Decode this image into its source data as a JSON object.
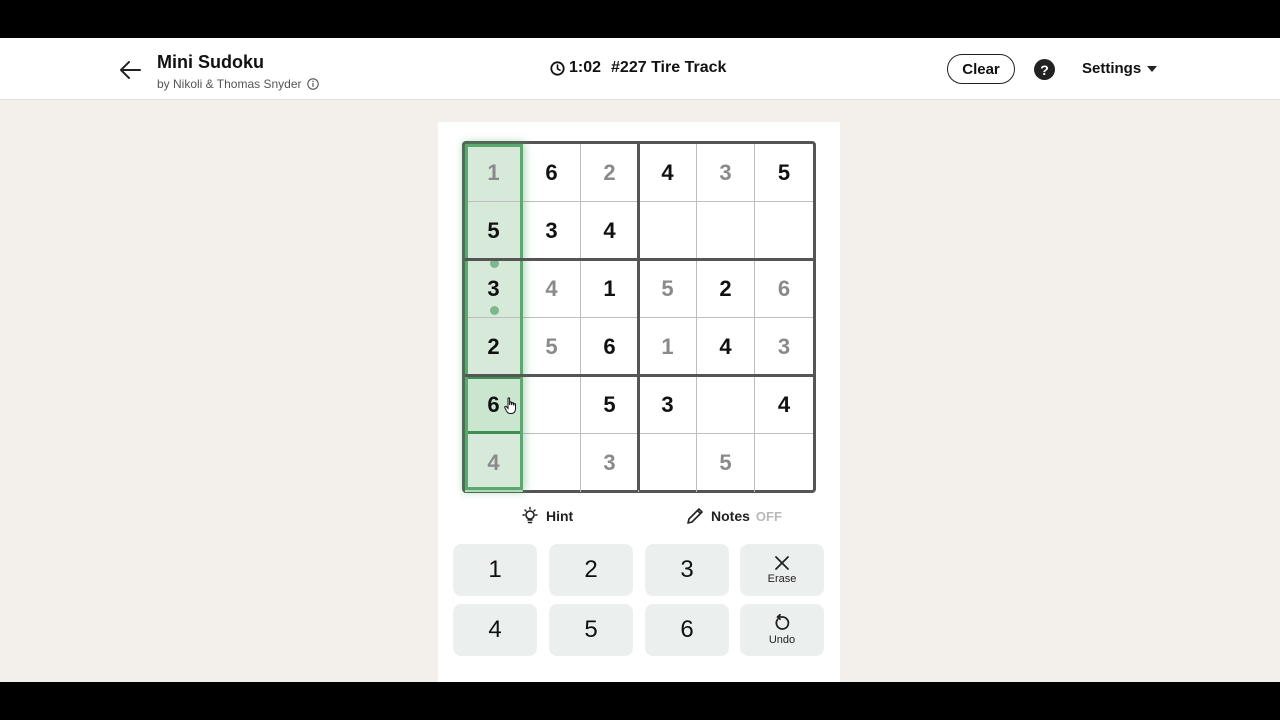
{
  "header": {
    "title": "Mini Sudoku",
    "byline": "by Nikoli & Thomas Snyder",
    "timer": "1:02",
    "puzzle_label": "#227 Tire Track",
    "clear_label": "Clear",
    "help_label": "?",
    "settings_label": "Settings"
  },
  "board": {
    "selected_cell": {
      "row": 5,
      "col": 1
    },
    "highlighted_column": 1,
    "rows": [
      [
        {
          "v": "1",
          "t": "entered"
        },
        {
          "v": "6",
          "t": "given"
        },
        {
          "v": "2",
          "t": "entered"
        },
        {
          "v": "4",
          "t": "given"
        },
        {
          "v": "3",
          "t": "entered"
        },
        {
          "v": "5",
          "t": "given"
        }
      ],
      [
        {
          "v": "5",
          "t": "given"
        },
        {
          "v": "3",
          "t": "given"
        },
        {
          "v": "4",
          "t": "given"
        },
        {
          "v": "",
          "t": "empty"
        },
        {
          "v": "",
          "t": "empty"
        },
        {
          "v": "",
          "t": "empty"
        }
      ],
      [
        {
          "v": "3",
          "t": "given"
        },
        {
          "v": "4",
          "t": "entered"
        },
        {
          "v": "1",
          "t": "given"
        },
        {
          "v": "5",
          "t": "entered"
        },
        {
          "v": "2",
          "t": "given"
        },
        {
          "v": "6",
          "t": "entered"
        }
      ],
      [
        {
          "v": "2",
          "t": "given"
        },
        {
          "v": "5",
          "t": "entered"
        },
        {
          "v": "6",
          "t": "given"
        },
        {
          "v": "1",
          "t": "entered"
        },
        {
          "v": "4",
          "t": "given"
        },
        {
          "v": "3",
          "t": "entered"
        }
      ],
      [
        {
          "v": "6",
          "t": "given"
        },
        {
          "v": "",
          "t": "empty"
        },
        {
          "v": "5",
          "t": "given"
        },
        {
          "v": "3",
          "t": "given"
        },
        {
          "v": "",
          "t": "empty"
        },
        {
          "v": "4",
          "t": "given"
        }
      ],
      [
        {
          "v": "4",
          "t": "entered"
        },
        {
          "v": "",
          "t": "empty"
        },
        {
          "v": "3",
          "t": "entered"
        },
        {
          "v": "",
          "t": "empty"
        },
        {
          "v": "5",
          "t": "entered"
        },
        {
          "v": "",
          "t": "empty"
        }
      ]
    ]
  },
  "tools": {
    "hint_label": "Hint",
    "notes_label": "Notes",
    "notes_state": "OFF"
  },
  "keypad": {
    "keys": [
      "1",
      "2",
      "3",
      "4",
      "5",
      "6"
    ],
    "erase_label": "Erase",
    "undo_label": "Undo"
  },
  "colors": {
    "highlight": "#d7ead9",
    "selected_border": "#3e8f52",
    "key_bg": "#ebf0ee",
    "app_bg": "#f3efeb"
  }
}
